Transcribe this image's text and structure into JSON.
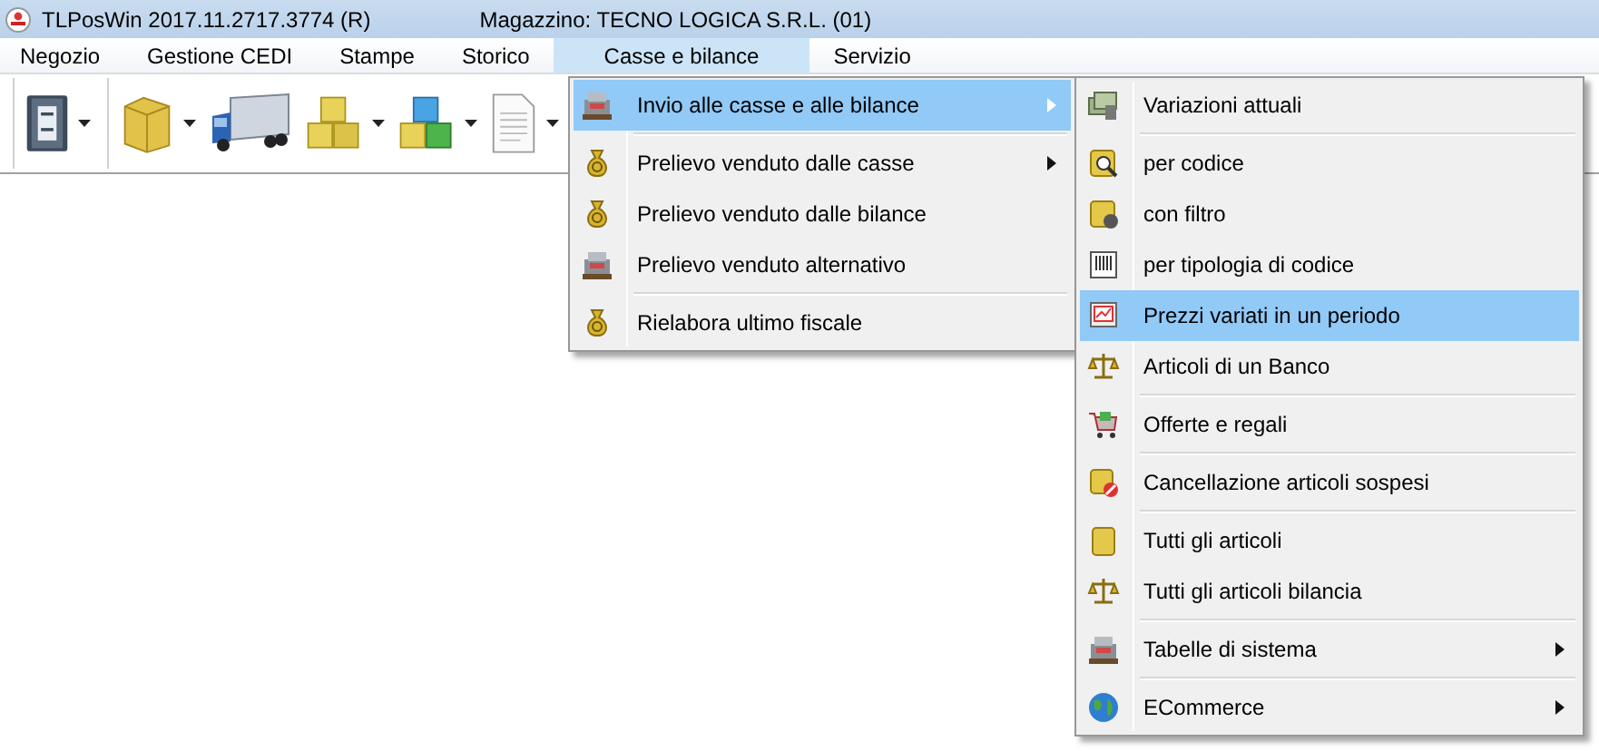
{
  "window": {
    "title": "TLPosWin 2017.11.2717.3774 (R)",
    "subtitle": "Magazzino: TECNO LOGICA S.R.L. (01)"
  },
  "menu_bar": [
    {
      "label": "Negozio",
      "selected": false
    },
    {
      "label": "Gestione CEDI",
      "selected": false
    },
    {
      "label": "Stampe",
      "selected": false
    },
    {
      "label": "Storico",
      "selected": false
    },
    {
      "label": "Casse e bilance",
      "selected": true
    },
    {
      "label": "Servizio",
      "selected": false
    }
  ],
  "toolbar": [
    {
      "kind": "book",
      "dropdown": true
    },
    {
      "kind": "box",
      "dropdown": true
    },
    {
      "kind": "truck",
      "dropdown": false
    },
    {
      "kind": "cubes",
      "dropdown": true
    },
    {
      "kind": "color-cubes",
      "dropdown": true
    },
    {
      "kind": "document",
      "dropdown": true
    }
  ],
  "menu": [
    {
      "label": "Invio alle casse e alle bilance",
      "kind": "register",
      "submenu": true,
      "selected": true,
      "separator_after": true
    },
    {
      "label": "Prelievo venduto dalle casse",
      "kind": "moneybag",
      "submenu": true,
      "selected": false,
      "separator_after": false
    },
    {
      "label": "Prelievo venduto dalle bilance",
      "kind": "moneybag",
      "submenu": false,
      "selected": false,
      "separator_after": false
    },
    {
      "label": "Prelievo venduto alternativo",
      "kind": "register",
      "submenu": false,
      "selected": false,
      "separator_after": true
    },
    {
      "label": "Rielabora ultimo fiscale",
      "kind": "moneybag",
      "submenu": false,
      "selected": false,
      "separator_after": false
    }
  ],
  "submenu": [
    {
      "label": "Variazioni attuali",
      "kind": "money-stack",
      "submenu": false,
      "selected": false,
      "separator_after": true
    },
    {
      "label": "per codice",
      "kind": "search-box",
      "submenu": false,
      "selected": false,
      "separator_after": false
    },
    {
      "label": "con filtro",
      "kind": "filter-box",
      "submenu": false,
      "selected": false,
      "separator_after": false
    },
    {
      "label": "per tipologia di codice",
      "kind": "barcode",
      "submenu": false,
      "selected": false,
      "separator_after": false
    },
    {
      "label": "Prezzi variati in un periodo",
      "kind": "price-chart",
      "submenu": false,
      "selected": true,
      "separator_after": false
    },
    {
      "label": "Articoli di un Banco",
      "kind": "scale",
      "submenu": false,
      "selected": false,
      "separator_after": true
    },
    {
      "label": "Offerte e regali",
      "kind": "cart",
      "submenu": false,
      "selected": false,
      "separator_after": true
    },
    {
      "label": "Cancellazione articoli sospesi",
      "kind": "cancel-box",
      "submenu": false,
      "selected": false,
      "separator_after": true
    },
    {
      "label": "Tutti gli articoli",
      "kind": "box",
      "submenu": false,
      "selected": false,
      "separator_after": false
    },
    {
      "label": "Tutti gli articoli bilancia",
      "kind": "scale",
      "submenu": false,
      "selected": false,
      "separator_after": true
    },
    {
      "label": "Tabelle di sistema",
      "kind": "register",
      "submenu": true,
      "selected": false,
      "separator_after": true
    },
    {
      "label": "ECommerce",
      "kind": "globe",
      "submenu": true,
      "selected": false,
      "separator_after": false
    }
  ]
}
